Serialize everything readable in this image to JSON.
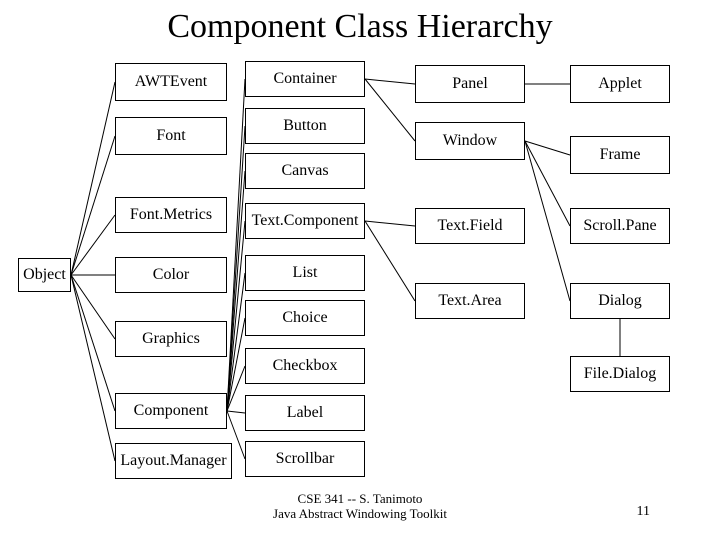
{
  "title": "Component Class Hierarchy",
  "boxes": {
    "object": "Object",
    "awtevent": "AWTEvent",
    "font": "Font",
    "fontmetrics": "Font.Metrics",
    "color": "Color",
    "graphics": "Graphics",
    "component": "Component",
    "layoutmanager": "Layout.Manager",
    "container": "Container",
    "button": "Button",
    "canvas": "Canvas",
    "textcomponent": "Text.Component",
    "list": "List",
    "choice": "Choice",
    "checkbox": "Checkbox",
    "label": "Label",
    "scrollbar": "Scrollbar",
    "panel": "Panel",
    "window": "Window",
    "textfield": "Text.Field",
    "textarea": "Text.Area",
    "applet": "Applet",
    "frame": "Frame",
    "scrollpane": "Scroll.Pane",
    "dialog": "Dialog",
    "filedialog": "File.Dialog"
  },
  "footer_line1": "CSE 341 -- S. Tanimoto",
  "footer_line2": "Java Abstract Windowing Toolkit",
  "page_number": "11"
}
